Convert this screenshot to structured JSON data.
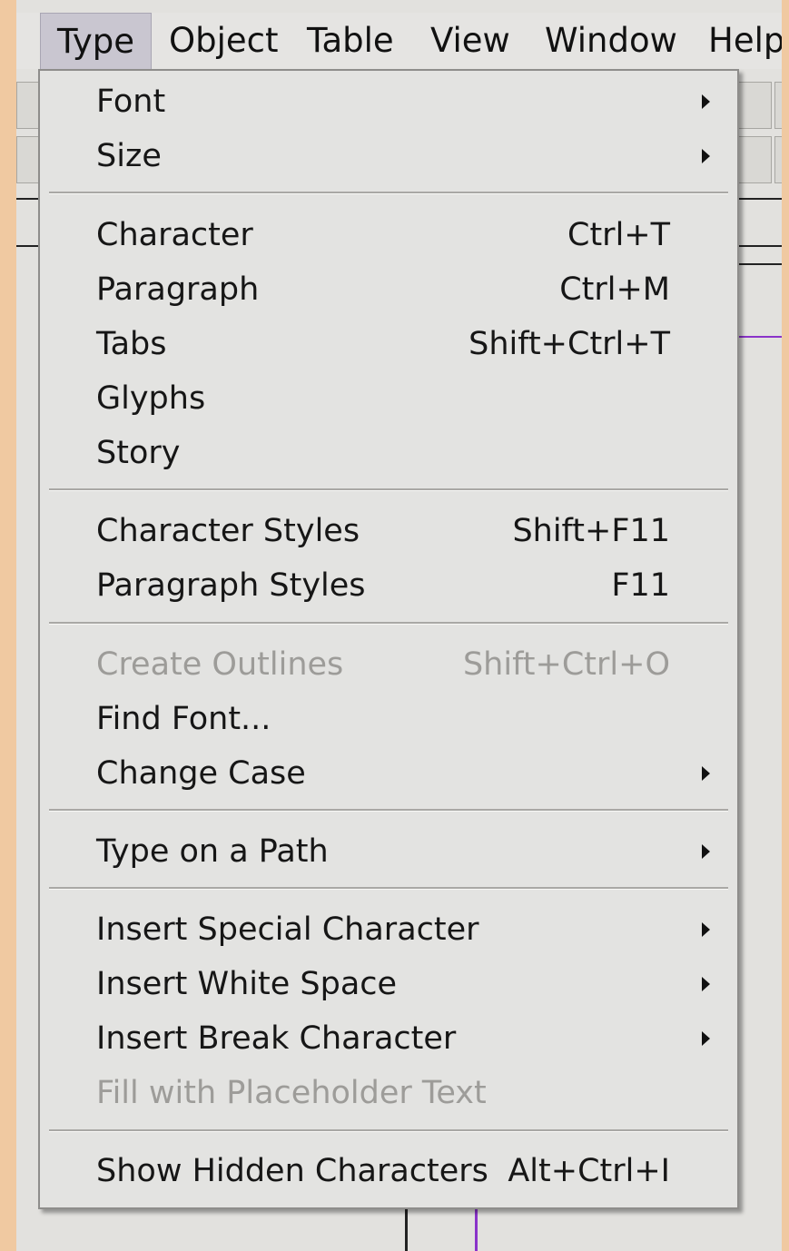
{
  "menubar": {
    "items": [
      {
        "label": "Type"
      },
      {
        "label": "Object"
      },
      {
        "label": "Table"
      },
      {
        "label": "View"
      },
      {
        "label": "Window"
      },
      {
        "label": "Help"
      }
    ],
    "active": "Type"
  },
  "menu": {
    "items": [
      {
        "label": "Font",
        "shortcut": "",
        "submenu": true,
        "enabled": true
      },
      {
        "label": "Size",
        "shortcut": "",
        "submenu": true,
        "enabled": true
      },
      {
        "label": "Character",
        "shortcut": "Ctrl+T",
        "submenu": false,
        "enabled": true
      },
      {
        "label": "Paragraph",
        "shortcut": "Ctrl+M",
        "submenu": false,
        "enabled": true
      },
      {
        "label": "Tabs",
        "shortcut": "Shift+Ctrl+T",
        "submenu": false,
        "enabled": true
      },
      {
        "label": "Glyphs",
        "shortcut": "",
        "submenu": false,
        "enabled": true
      },
      {
        "label": "Story",
        "shortcut": "",
        "submenu": false,
        "enabled": true
      },
      {
        "label": "Character Styles",
        "shortcut": "Shift+F11",
        "submenu": false,
        "enabled": true
      },
      {
        "label": "Paragraph Styles",
        "shortcut": "F11",
        "submenu": false,
        "enabled": true
      },
      {
        "label": "Create Outlines",
        "shortcut": "Shift+Ctrl+O",
        "submenu": false,
        "enabled": false
      },
      {
        "label": "Find Font...",
        "shortcut": "",
        "submenu": false,
        "enabled": true
      },
      {
        "label": "Change Case",
        "shortcut": "",
        "submenu": true,
        "enabled": true
      },
      {
        "label": "Type on a Path",
        "shortcut": "",
        "submenu": true,
        "enabled": true
      },
      {
        "label": "Insert Special Character",
        "shortcut": "",
        "submenu": true,
        "enabled": true
      },
      {
        "label": "Insert White Space",
        "shortcut": "",
        "submenu": true,
        "enabled": true
      },
      {
        "label": "Insert Break Character",
        "shortcut": "",
        "submenu": true,
        "enabled": true
      },
      {
        "label": "Fill with Placeholder Text",
        "shortcut": "",
        "submenu": false,
        "enabled": false
      },
      {
        "label": "Show Hidden Characters",
        "shortcut": "Alt+Ctrl+I",
        "submenu": false,
        "enabled": true
      }
    ]
  },
  "colors": {
    "page_background": "#f0c9a1",
    "menu_background": "#e3e3e1",
    "active_menubar_item": "#c9c6d0",
    "guide": "#8a33c9",
    "disabled_text": "#9d9c99"
  }
}
